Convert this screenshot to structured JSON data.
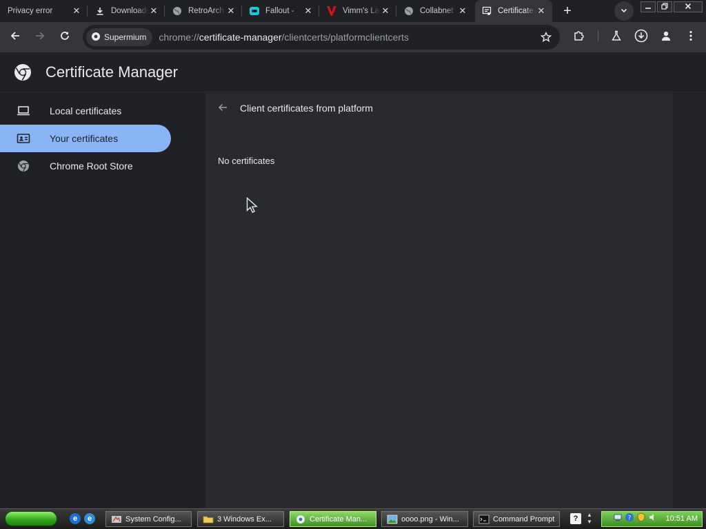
{
  "browser": {
    "tabs": [
      {
        "title": "Privacy error",
        "icon": "none"
      },
      {
        "title": "Downloads",
        "icon": "download-icon"
      },
      {
        "title": "RetroArch",
        "icon": "globe-icon"
      },
      {
        "title": "Fallout -",
        "icon": "gamepad-icon"
      },
      {
        "title": "Vimm's Lair",
        "icon": "vimm-logo-icon"
      },
      {
        "title": "Collabnet",
        "icon": "globe-icon"
      },
      {
        "title": "Certificate Manager",
        "icon": "certificate-icon",
        "active": true
      }
    ],
    "new_tab_label": "+",
    "omnibox": {
      "chip_label": "Supermium",
      "url_scheme": "chrome://",
      "url_host": "certificate-manager",
      "url_path": "/clientcerts/platformclientcerts"
    }
  },
  "app": {
    "title": "Certificate Manager"
  },
  "sidebar": {
    "items": [
      {
        "label": "Local certificates",
        "icon": "laptop-icon"
      },
      {
        "label": "Your certificates",
        "icon": "id-card-icon",
        "selected": true
      },
      {
        "label": "Chrome Root Store",
        "icon": "chrome-icon"
      }
    ]
  },
  "main": {
    "heading": "Client certificates from platform",
    "empty_message": "No certificates"
  },
  "taskbar": {
    "tasks": [
      {
        "label": "System Config..."
      },
      {
        "label": "3 Windows Ex..."
      },
      {
        "label": "Certificate Man...",
        "active": true
      },
      {
        "label": "oooo.png - Win..."
      },
      {
        "label": "Command Prompt"
      }
    ],
    "clock": "10:51 AM"
  },
  "colors": {
    "background": "#202124",
    "accent_selected": "#8ab4f8",
    "content_panel": "#292a2d",
    "toolbar": "#35363a"
  }
}
